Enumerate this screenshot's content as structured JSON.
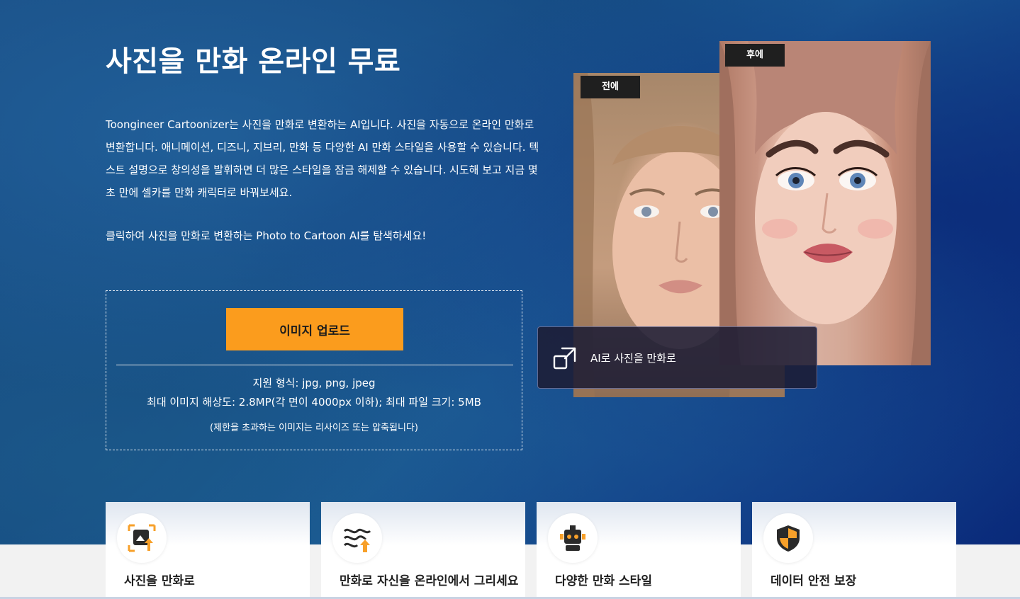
{
  "hero": {
    "title": "사진을 만화 온라인 무료",
    "description": "Toongineer Cartoonizer는 사진을 만화로 변환하는 AI입니다. 사진을 자동으로 온라인 만화로 변환합니다. 애니메이션, 디즈니, 지브리, 만화 등 다양한 AI 만화 스타일을 사용할 수 있습니다. 텍스트 설명으로 창의성을 발휘하면 더 많은 스타일을 잠금 해제할 수 있습니다. 시도해 보고 지금 몇 초 만에 셀카를 만화 캐릭터로 바꿔보세요.",
    "cta_text": "클릭하여 사진을 만화로 변환하는 Photo to Cartoon AI를 탐색하세요!"
  },
  "upload": {
    "button_label": "이미지 업로드",
    "formats": "지원 형식: jpg, png, jpeg",
    "limits": "최대 이미지 해상도: 2.8MP(각 면이 4000px 이하); 최대 파일 크기: 5MB",
    "note": "(제한을 초과하는 이미지는 리사이즈 또는 압축됩니다)"
  },
  "preview": {
    "before_label": "전에",
    "after_label": "후에",
    "ai_label": "AI로 사진을 만화로"
  },
  "features": [
    {
      "title": "사진을 만화로",
      "icon": "photo-convert-icon"
    },
    {
      "title": "만화로 자신을 온라인에서 그리세요",
      "icon": "waves-upload-icon"
    },
    {
      "title": "다양한 만화 스타일",
      "icon": "robot-icon"
    },
    {
      "title": "데이터 안전 보장",
      "icon": "shield-icon"
    }
  ],
  "colors": {
    "accent": "#fb9c1d",
    "hero_bg": "#154a82"
  }
}
